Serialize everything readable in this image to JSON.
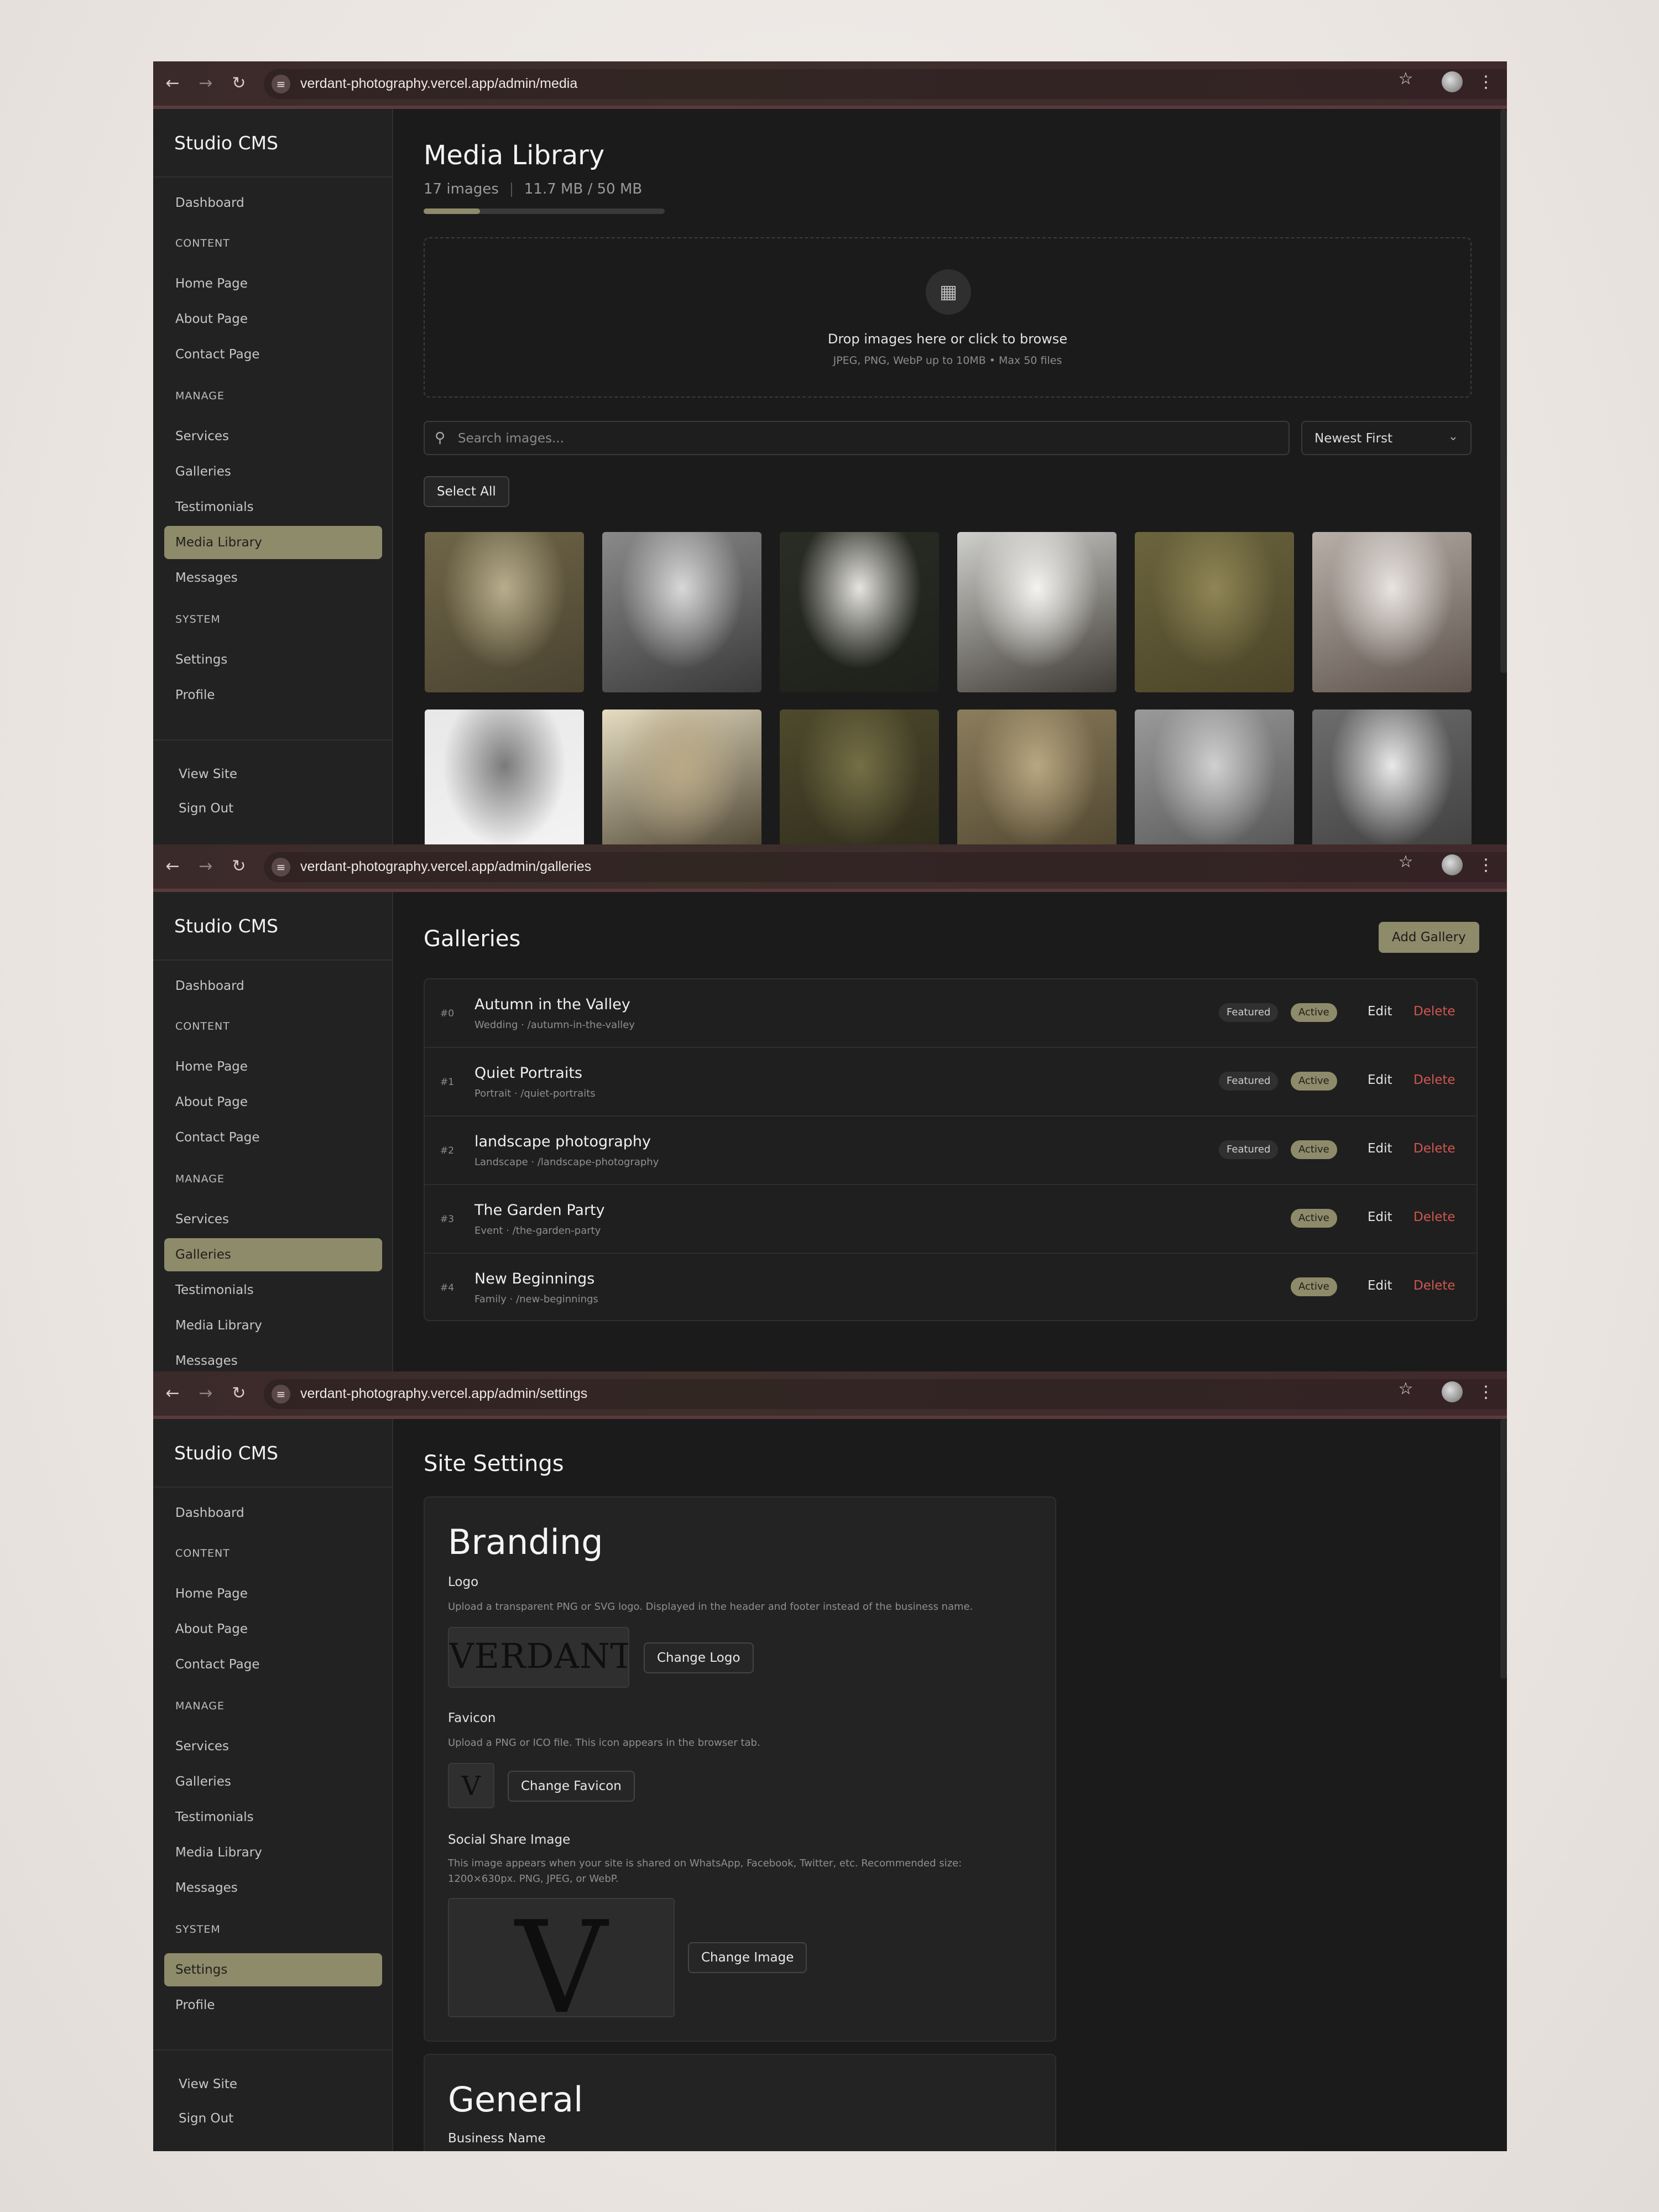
{
  "shots": [
    {
      "url": "verdant-photography.vercel.app/admin/media"
    },
    {
      "url": "verdant-photography.vercel.app/admin/galleries"
    },
    {
      "url": "verdant-photography.vercel.app/admin/settings"
    }
  ],
  "sidebar": {
    "brand": "Studio CMS",
    "dashboard": "Dashboard",
    "content_header": "CONTENT",
    "home_page": "Home Page",
    "about_page": "About Page",
    "contact_page": "Contact Page",
    "manage_header": "MANAGE",
    "services": "Services",
    "galleries": "Galleries",
    "testimonials": "Testimonials",
    "media_library": "Media Library",
    "messages": "Messages",
    "system_header": "SYSTEM",
    "settings": "Settings",
    "profile": "Profile",
    "view_site": "View Site",
    "sign_out": "Sign Out"
  },
  "media": {
    "title": "Media Library",
    "count": "17 images",
    "storage": "11.7 MB / 50 MB",
    "storage_used_fraction": 0.234,
    "drop_title": "Drop images here or click to browse",
    "drop_hint": "JPEG, PNG, WebP up to 10MB • Max 50 files",
    "search_placeholder": "Search images...",
    "sort_value": "Newest First",
    "select_all": "Select All"
  },
  "galleries": {
    "title": "Galleries",
    "add_button": "Add Gallery",
    "featured_label": "Featured",
    "active_label": "Active",
    "edit_label": "Edit",
    "delete_label": "Delete",
    "rows": [
      {
        "idx": "#0",
        "name": "Autumn in the Valley",
        "sub": "Wedding · /autumn-in-the-valley",
        "featured": true
      },
      {
        "idx": "#1",
        "name": "Quiet Portraits",
        "sub": "Portrait · /quiet-portraits",
        "featured": true
      },
      {
        "idx": "#2",
        "name": "landscape photography",
        "sub": "Landscape · /landscape-photography",
        "featured": true
      },
      {
        "idx": "#3",
        "name": "The Garden Party",
        "sub": "Event · /the-garden-party",
        "featured": false
      },
      {
        "idx": "#4",
        "name": "New Beginnings",
        "sub": "Family · /new-beginnings",
        "featured": false
      }
    ]
  },
  "settings": {
    "title": "Site Settings",
    "branding_title": "Branding",
    "logo_label": "Logo",
    "logo_help": "Upload a transparent PNG or SVG logo. Displayed in the header and footer instead of the business name.",
    "logo_preview": "VERDANT",
    "change_logo": "Change Logo",
    "favicon_label": "Favicon",
    "favicon_help": "Upload a PNG or ICO file. This icon appears in the browser tab.",
    "favicon_preview": "V",
    "change_favicon": "Change Favicon",
    "share_label": "Social Share Image",
    "share_help": "This image appears when your site is shared on WhatsApp, Facebook, Twitter, etc. Recommended size: 1200×630px. PNG, JPEG, or WebP.",
    "share_preview": "V",
    "change_image": "Change Image",
    "general_title": "General",
    "business_name_label": "Business Name"
  },
  "colors": {
    "accent": "#8e8b6b",
    "danger": "#d1564f",
    "background": "#1b1b1b",
    "sidebar": "#222222"
  },
  "thumbnails": [
    {
      "name": "wildflower-meadow",
      "colors": [
        "#6f6548",
        "#b8ad8c",
        "#4a4330"
      ]
    },
    {
      "name": "white-daisies-bw",
      "colors": [
        "#8a8a8a",
        "#d8d8d8",
        "#3a3a3a"
      ]
    },
    {
      "name": "bride-dress-forest",
      "colors": [
        "#2a2d25",
        "#e6e4df",
        "#1e201b"
      ]
    },
    {
      "name": "flowing-white-dress",
      "colors": [
        "#cfcfcb",
        "#f4f3ef",
        "#3e3a35"
      ]
    },
    {
      "name": "woman-in-grass",
      "colors": [
        "#6b643d",
        "#8f8555",
        "#4b4428"
      ]
    },
    {
      "name": "hands-on-dress",
      "colors": [
        "#b9afa9",
        "#e8e4e0",
        "#5d524c"
      ]
    },
    {
      "name": "bride-veil-bw",
      "colors": [
        "#e8e8e8",
        "#7a7a7a",
        "#f4f4f4"
      ]
    },
    {
      "name": "sunlit-silhouette",
      "colors": [
        "#e5dcc2",
        "#b9a985",
        "#3e3524"
      ]
    },
    {
      "name": "field-with-dog",
      "colors": [
        "#4e4a2d",
        "#756f45",
        "#2d2a1b"
      ]
    },
    {
      "name": "bouquet-in-grass",
      "colors": [
        "#8b7d5c",
        "#b8a781",
        "#4b412c"
      ]
    },
    {
      "name": "face-behind-veil",
      "colors": [
        "#9a9a9a",
        "#d0d0d0",
        "#505050"
      ]
    },
    {
      "name": "bride-garden-bw",
      "colors": [
        "#6d6d6d",
        "#e9e9e9",
        "#3c3c3c"
      ]
    }
  ]
}
